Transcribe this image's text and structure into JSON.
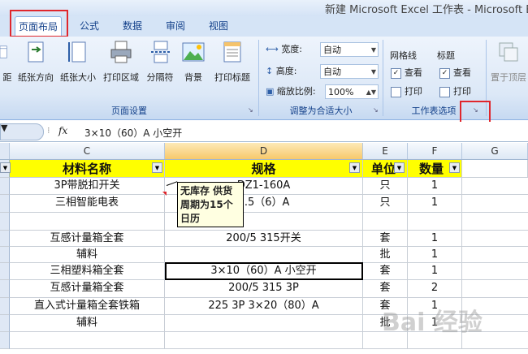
{
  "window": {
    "title": "新建 Microsoft Excel 工作表 - Microsoft E"
  },
  "tabs": [
    {
      "label": "页面布局",
      "active": true
    },
    {
      "label": "公式"
    },
    {
      "label": "数据"
    },
    {
      "label": "审阅"
    },
    {
      "label": "视图"
    }
  ],
  "ribbon": {
    "page_setup": {
      "label": "页面设置",
      "buttons": [
        "距",
        "纸张方向",
        "纸张大小",
        "打印区域",
        "分隔符",
        "背景",
        "打印标题"
      ]
    },
    "scale_to_fit": {
      "label": "调整为合适大小",
      "width_label": "宽度:",
      "width_value": "自动",
      "height_label": "高度:",
      "height_value": "自动",
      "scale_label": "缩放比例:",
      "scale_value": "100%"
    },
    "sheet_options": {
      "label": "工作表选项",
      "gridlines_label": "网格线",
      "headings_label": "标题",
      "view_label": "查看",
      "print_label": "打印",
      "gridlines_view": true,
      "gridlines_print": false,
      "headings_view": true,
      "headings_print": false
    },
    "arrange": {
      "bring_front": "置于顶层"
    }
  },
  "formula_bar": {
    "fx": "fx",
    "value": "3×10（60）A 小空开"
  },
  "columns": [
    {
      "id": "C"
    },
    {
      "id": "D"
    },
    {
      "id": "E"
    },
    {
      "id": "F"
    },
    {
      "id": "G"
    }
  ],
  "header_row": {
    "c": "材料名称",
    "d": "规格",
    "e": "单位",
    "f": "数量"
  },
  "rows": [
    {
      "c": "3P带脱扣开关",
      "d": "DZ1-160A",
      "e": "只",
      "f": "1"
    },
    {
      "c": "三相智能电表",
      "d": "1.5（6）A",
      "e": "只",
      "f": "1"
    },
    {
      "c": "",
      "d": "",
      "e": "",
      "f": ""
    },
    {
      "c": "互感计量箱全套",
      "d": "200/5 315开关",
      "e": "套",
      "f": "1"
    },
    {
      "c": "辅料",
      "d": "",
      "e": "批",
      "f": "1"
    },
    {
      "c": "三相塑料箱全套",
      "d": "3×10（60）A 小空开",
      "e": "套",
      "f": "1"
    },
    {
      "c": "互感计量箱全套",
      "d": "200/5 315 3P",
      "e": "套",
      "f": "2"
    },
    {
      "c": "直入式计量箱全套铁箱",
      "d": "225 3P 3×20（80）A",
      "e": "套",
      "f": "1"
    },
    {
      "c": "辅料",
      "d": "",
      "e": "批",
      "f": "1"
    },
    {
      "c": "",
      "d": "",
      "e": "",
      "f": ""
    }
  ],
  "comment": {
    "text": "无库存 供货周期为15个日历"
  },
  "watermark": "Bai 经验"
}
